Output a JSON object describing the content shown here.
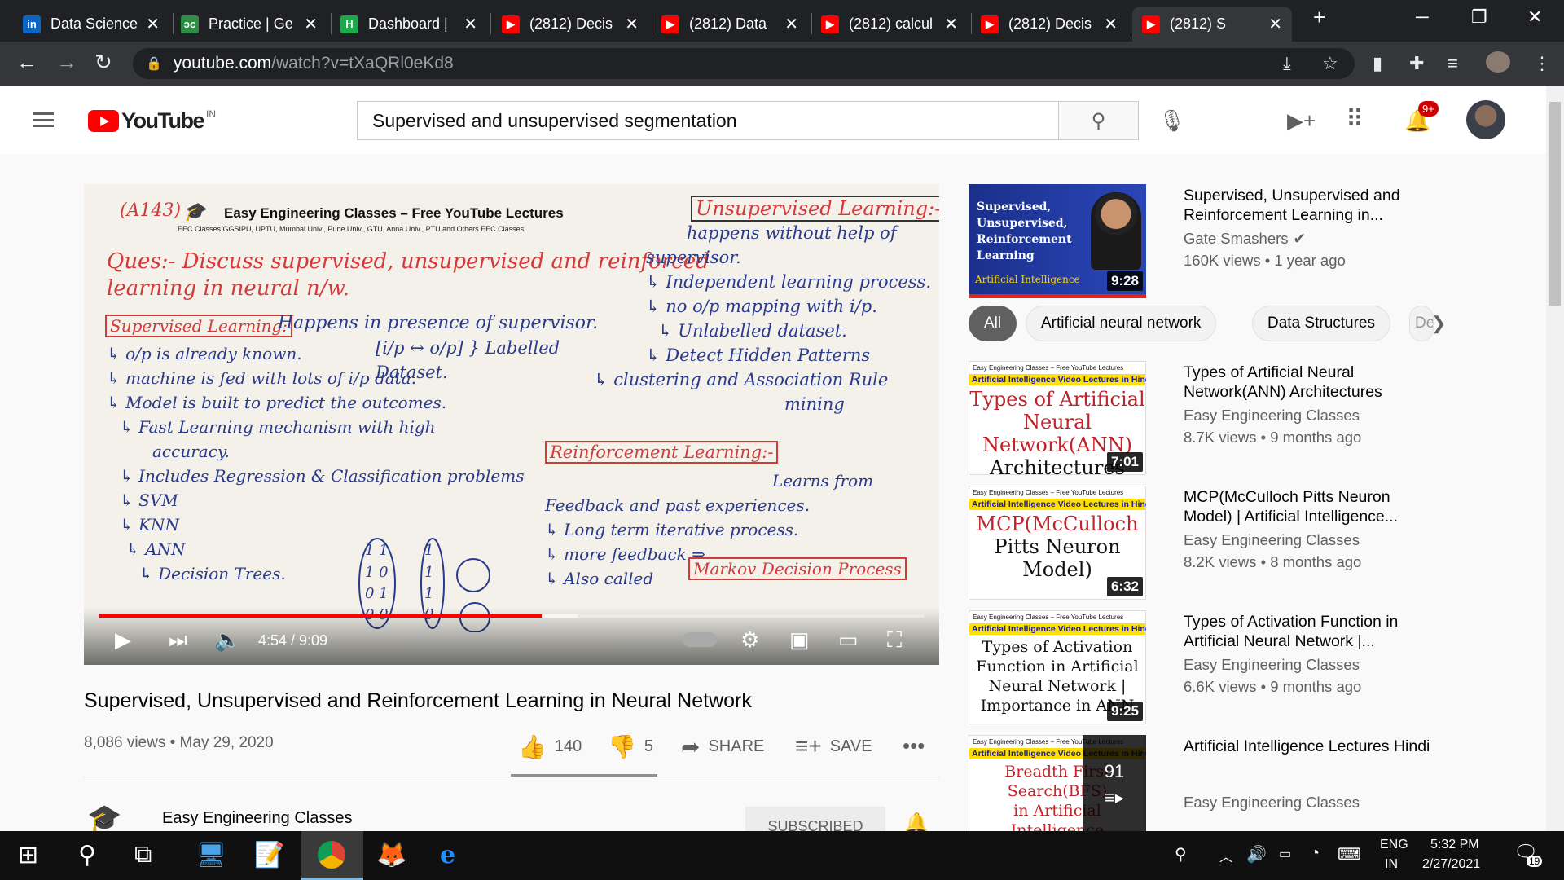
{
  "browser": {
    "tabs": [
      {
        "title": "Data Science",
        "favicon": "linkedin-icon",
        "color": "#0a66c2",
        "glyph": "in"
      },
      {
        "title": "Practice | Ge",
        "favicon": "gfg-icon",
        "color": "#2f8d46",
        "glyph": "ↄc"
      },
      {
        "title": "Dashboard |",
        "favicon": "hackerrank-icon",
        "color": "#1ba94c",
        "glyph": "H"
      },
      {
        "title": "(2812) Decis",
        "favicon": "youtube-icon",
        "color": "#ff0000",
        "glyph": "▶"
      },
      {
        "title": "(2812) Data",
        "favicon": "youtube-icon",
        "color": "#ff0000",
        "glyph": "▶"
      },
      {
        "title": "(2812) calcul",
        "favicon": "youtube-icon",
        "color": "#ff0000",
        "glyph": "▶"
      },
      {
        "title": "(2812) Decis",
        "favicon": "youtube-icon",
        "color": "#ff0000",
        "glyph": "▶"
      },
      {
        "title": "(2812) S",
        "favicon": "youtube-icon",
        "color": "#ff0000",
        "glyph": "▶"
      }
    ],
    "url_host": "youtube.com",
    "url_path": "/watch?v=tXaQRl0eKd8"
  },
  "youtube": {
    "region": "IN",
    "search_value": "Supervised and unsupervised segmentation",
    "notification_count": "9+"
  },
  "player": {
    "time": "4:54 / 9:09",
    "progress": 0.536,
    "buffered": 0.58,
    "board": {
      "code": "(A143)",
      "header": "Easy Engineering Classes – Free YouTube Lectures",
      "subheader": "EEC Classes   GGSIPU, UPTU, Mumbai Univ., Pune Univ., GTU, Anna Univ., PTU and Others   EEC Classes",
      "question": "Ques:- Discuss supervised, unsupervised and reinforced learning in neural n/w.",
      "q1": "Ques:- Discuss supervised, unsupervised and reinforced",
      "q2": "learning in neural n/w.",
      "sup_title": "Supervised Learning:",
      "sup_def": "Happens in presence of supervisor.",
      "sup_lines": [
        "↳ o/p is already known.",
        "↳ machine is fed with lots of i/p data.",
        "↳ Model is built to predict the outcomes.",
        "↳ Fast Learning mechanism with high",
        "accuracy.",
        "↳ Includes Regression & Classification problems",
        "↳ SVM",
        "↳ KNN",
        "↳ ANN",
        "↳ Decision Trees."
      ],
      "labelled": "[i/p ↔ o/p] } Labelled Dataset.",
      "unsup_title": "Unsupervised Learning:-",
      "unsup_lines": [
        "happens without help of",
        "supervisor.",
        "↳ Independent learning process.",
        "↳ no o/p mapping with i/p.",
        "↳ Unlabelled dataset.",
        "↳ Detect Hidden Patterns",
        "↳ clustering and Association Rule",
        "mining"
      ],
      "rl_title": "Reinforcement Learning:-",
      "rl_lines": [
        "Learns from",
        "Feedback and past experiences.",
        "↳ Long term iterative process.",
        "↳ more feedback ⇒",
        "↳ Also called"
      ],
      "markov": "Markov Decision Process"
    }
  },
  "video": {
    "title": "Supervised, Unsupervised and Reinforcement Learning in Neural Network",
    "meta": "8,086 views • May 29, 2020",
    "likes": "140",
    "dislikes": "5",
    "share": "SHARE",
    "save": "SAVE",
    "channel": "Easy Engineering Classes",
    "subscribe": "SUBSCRIBED"
  },
  "chips": [
    "All",
    "Artificial neural network",
    "Data Structures",
    "Dek"
  ],
  "sidebar": [
    {
      "title": "Supervised, Unsupervised and Reinforcement Learning in...",
      "channel": "Gate Smashers",
      "verified": "✔",
      "views": "160K views • 1 year ago",
      "duration": "9:28",
      "thumb": {
        "lines": [
          "Supervised,",
          "Unsupervised,",
          "Reinforcement",
          "Learning"
        ],
        "tag": "Artificial Intelligence"
      }
    },
    {
      "title": "Types of Artificial Neural Network(ANN) Architectures",
      "channel": "Easy Engineering Classes",
      "views": "8.7K views • 9 months ago",
      "duration": "7:01",
      "thumb": {
        "lines": [
          "Types of Artificial",
          "Neural Network(ANN)",
          "Architectures"
        ]
      }
    },
    {
      "title": "MCP(McCulloch Pitts Neuron Model) | Artificial Intelligence...",
      "channel": "Easy Engineering Classes",
      "views": "8.2K views • 8 months ago",
      "duration": "6:32",
      "thumb": {
        "lines": [
          "MCP(McCulloch",
          "Pitts Neuron",
          "Model)"
        ]
      }
    },
    {
      "title": "Types of Activation Function in Artificial Neural Network |...",
      "channel": "Easy Engineering Classes",
      "views": "6.6K views • 9 months ago",
      "duration": "9:25",
      "thumb": {
        "lines": [
          "Types of Activation",
          "Function in Artificial",
          "Neural Network |",
          "Importance in ANN"
        ]
      }
    },
    {
      "title": "Artificial Intelligence Lectures Hindi",
      "channel": "Easy Engineering Classes",
      "playlist_count": "91",
      "thumb": {
        "lines": [
          "Breadth First Search(BFS)",
          "in Artificial Intelligence"
        ]
      }
    }
  ],
  "eec_thumb": {
    "top": "Easy Engineering Classes – Free YouTube Lectures",
    "sub": "EEC Classes  GGSIPU, UPTU, Mumbai Univ., Pune Univ., GTU, Anna Univ., PTU and Others  EEC Classes",
    "ai": "Artificial Intelligence Video Lectures in Hindi"
  },
  "taskbar": {
    "lang1": "ENG",
    "lang2": "IN",
    "time": "5:32 PM",
    "date": "2/27/2021",
    "notifications": "19"
  }
}
